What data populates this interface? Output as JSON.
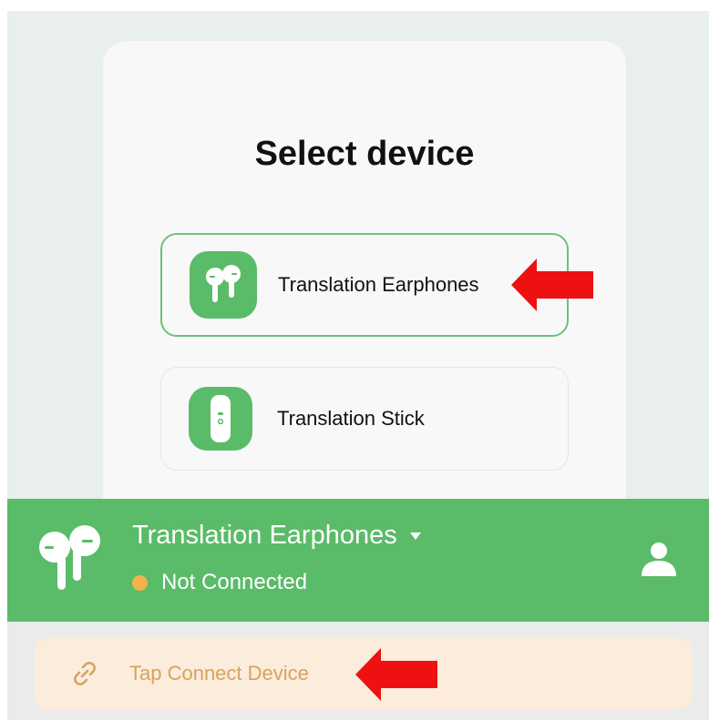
{
  "dialog": {
    "title": "Select device",
    "options": [
      {
        "label": "Translation Earphones",
        "icon": "earbuds-icon",
        "selected": true
      },
      {
        "label": "Translation Stick",
        "icon": "translation-stick-icon",
        "selected": false
      }
    ]
  },
  "header": {
    "device_name": "Translation Earphones",
    "status": "Not Connected",
    "status_color": "#f4b24b",
    "accent_color": "#5abb68"
  },
  "connect_banner": {
    "label": "Tap Connect Device",
    "icon": "link-icon",
    "text_color": "#d7a35c",
    "background": "#fbecdc"
  },
  "annotations": {
    "arrow_color": "#ee1111"
  }
}
